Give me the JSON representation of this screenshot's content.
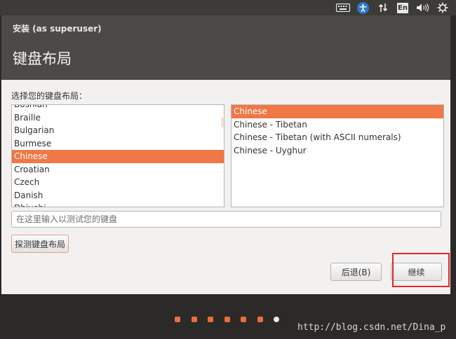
{
  "top_panel": {
    "icons": [
      "keyboard-icon",
      "accessibility-icon",
      "network-icon",
      "language-indicator",
      "volume-icon",
      "power-icon"
    ],
    "language_label": "En"
  },
  "window": {
    "title": "安装 (as superuser)",
    "page_title": "键盘布局"
  },
  "layout": {
    "choose_label": "选择您的键盘布局：",
    "layouts": [
      "Bosnian",
      "Braille",
      "Bulgarian",
      "Burmese",
      "Chinese",
      "Croatian",
      "Czech",
      "Danish",
      "Dhivehi"
    ],
    "selected_layout": "Chinese",
    "variants": [
      "Chinese",
      "Chinese - Tibetan",
      "Chinese - Tibetan (with ASCII numerals)",
      "Chinese - Uyghur"
    ],
    "selected_variant": "Chinese"
  },
  "test_field": {
    "placeholder": "在这里输入以测试您的键盘"
  },
  "buttons": {
    "detect": "探测键盘布局",
    "back": "后退(B)",
    "continue": "继续"
  },
  "progress": {
    "total_steps": 7,
    "current_step": 7
  },
  "watermark": "http://blog.csdn.net/Dina_p",
  "colors": {
    "accent": "#f07746",
    "highlight_box": "#e0262b",
    "header_bg": "#4c4a48"
  }
}
